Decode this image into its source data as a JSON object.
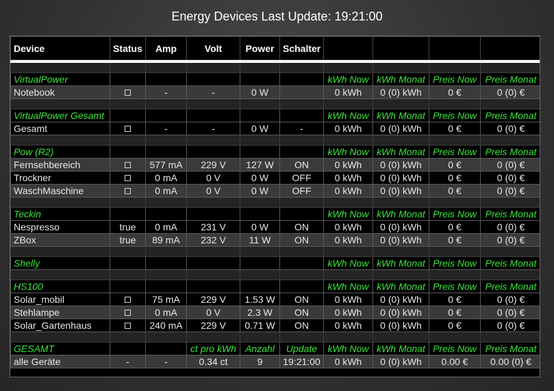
{
  "title": "Energy Devices  Last Update: 19:21:00",
  "columns": [
    "Device",
    "Status",
    "Amp",
    "Volt",
    "Power",
    "Schalter",
    "",
    "",
    "",
    ""
  ],
  "metric_headers": [
    "kWh Now",
    "kWh Monat",
    "Preis Now",
    "Preis Monat"
  ],
  "groups": [
    {
      "name": "VirtualPower",
      "rows": [
        {
          "device": "Notebook",
          "status": "checkbox",
          "amp": "-",
          "volt": "-",
          "power": "0 W",
          "schalter": "",
          "kwh_now": "0 kWh",
          "kwh_monat": "0 (0) kWh",
          "preis_now": "0 €",
          "preis_monat": "0 (0) €"
        }
      ]
    },
    {
      "name": "VirtualPower Gesamt",
      "rows": [
        {
          "device": "Gesamt",
          "status": "checkbox",
          "amp": "-",
          "volt": "-",
          "power": "0 W",
          "schalter": "-",
          "kwh_now": "0 kWh",
          "kwh_monat": "0 (0) kWh",
          "preis_now": "0 €",
          "preis_monat": "0 (0) €"
        }
      ]
    },
    {
      "name": "Pow (R2)",
      "rows": [
        {
          "device": "Fernsehbereich",
          "status": "checkbox",
          "amp": "577 mA",
          "volt": "229 V",
          "power": "127 W",
          "schalter": "ON",
          "kwh_now": "0 kWh",
          "kwh_monat": "0 (0) kWh",
          "preis_now": "0 €",
          "preis_monat": "0 (0) €"
        },
        {
          "device": "Trockner",
          "status": "checkbox",
          "amp": "0 mA",
          "volt": "0 V",
          "power": "0 W",
          "schalter": "OFF",
          "kwh_now": "0 kWh",
          "kwh_monat": "0 (0) kWh",
          "preis_now": "0 €",
          "preis_monat": "0 (0) €"
        },
        {
          "device": "WaschMaschine",
          "status": "checkbox",
          "amp": "0 mA",
          "volt": "0 V",
          "power": "0 W",
          "schalter": "OFF",
          "kwh_now": "0 kWh",
          "kwh_monat": "0 (0) kWh",
          "preis_now": "0 €",
          "preis_monat": "0 (0) €"
        }
      ]
    },
    {
      "name": "Teckin",
      "rows": [
        {
          "device": "Nespresso",
          "status": "true",
          "amp": "0 mA",
          "volt": "231 V",
          "power": "0 W",
          "schalter": "ON",
          "kwh_now": "0 kWh",
          "kwh_monat": "0 (0) kWh",
          "preis_now": "0 €",
          "preis_monat": "0 (0) €"
        },
        {
          "device": "ZBox",
          "status": "true",
          "amp": "89 mA",
          "volt": "232 V",
          "power": "11 W",
          "schalter": "ON",
          "kwh_now": "0 kWh",
          "kwh_monat": "0 (0) kWh",
          "preis_now": "0 €",
          "preis_monat": "0 (0) €"
        }
      ]
    },
    {
      "name": "Shelly",
      "rows": []
    },
    {
      "name": "HS100",
      "rows": [
        {
          "device": "Solar_mobil",
          "status": "checkbox",
          "amp": "75 mA",
          "volt": "229 V",
          "power": "1.53 W",
          "schalter": "ON",
          "kwh_now": "0 kWh",
          "kwh_monat": "0 (0) kWh",
          "preis_now": "0 €",
          "preis_monat": "0 (0) €"
        },
        {
          "device": "Stehlampe",
          "status": "checkbox",
          "amp": "0 mA",
          "volt": "0 V",
          "power": "2.3 W",
          "schalter": "ON",
          "kwh_now": "0 kWh",
          "kwh_monat": "0 (0) kWh",
          "preis_now": "0 €",
          "preis_monat": "0 (0) €"
        },
        {
          "device": "Solar_Gartenhaus",
          "status": "checkbox",
          "amp": "240 mA",
          "volt": "229 V",
          "power": "0.71 W",
          "schalter": "ON",
          "kwh_now": "0 kWh",
          "kwh_monat": "0 (0) kWh",
          "preis_now": "0 €",
          "preis_monat": "0 (0) €"
        }
      ]
    }
  ],
  "gesamt": {
    "name": "GESAMT",
    "headers": [
      "ct pro kWh",
      "Anzahl",
      "Update",
      "kWh Now",
      "kWh Monat",
      "Preis Now",
      "Preis Monat"
    ],
    "row": {
      "device": "alle Geräte",
      "status": "-",
      "amp": "-",
      "ct": "0.34 ct",
      "anzahl": "9",
      "update": "19:21:00",
      "kwh_now": "0 kWh",
      "kwh_monat": "0 (0) kWh",
      "preis_now": "0.00 €",
      "preis_monat": "0.00 (0) €"
    }
  },
  "colors": {
    "on": "#39e639",
    "off": "#ff2a2a",
    "group": "#39e639",
    "row_odd": "#3a3a3a",
    "row_even": "#000000"
  }
}
